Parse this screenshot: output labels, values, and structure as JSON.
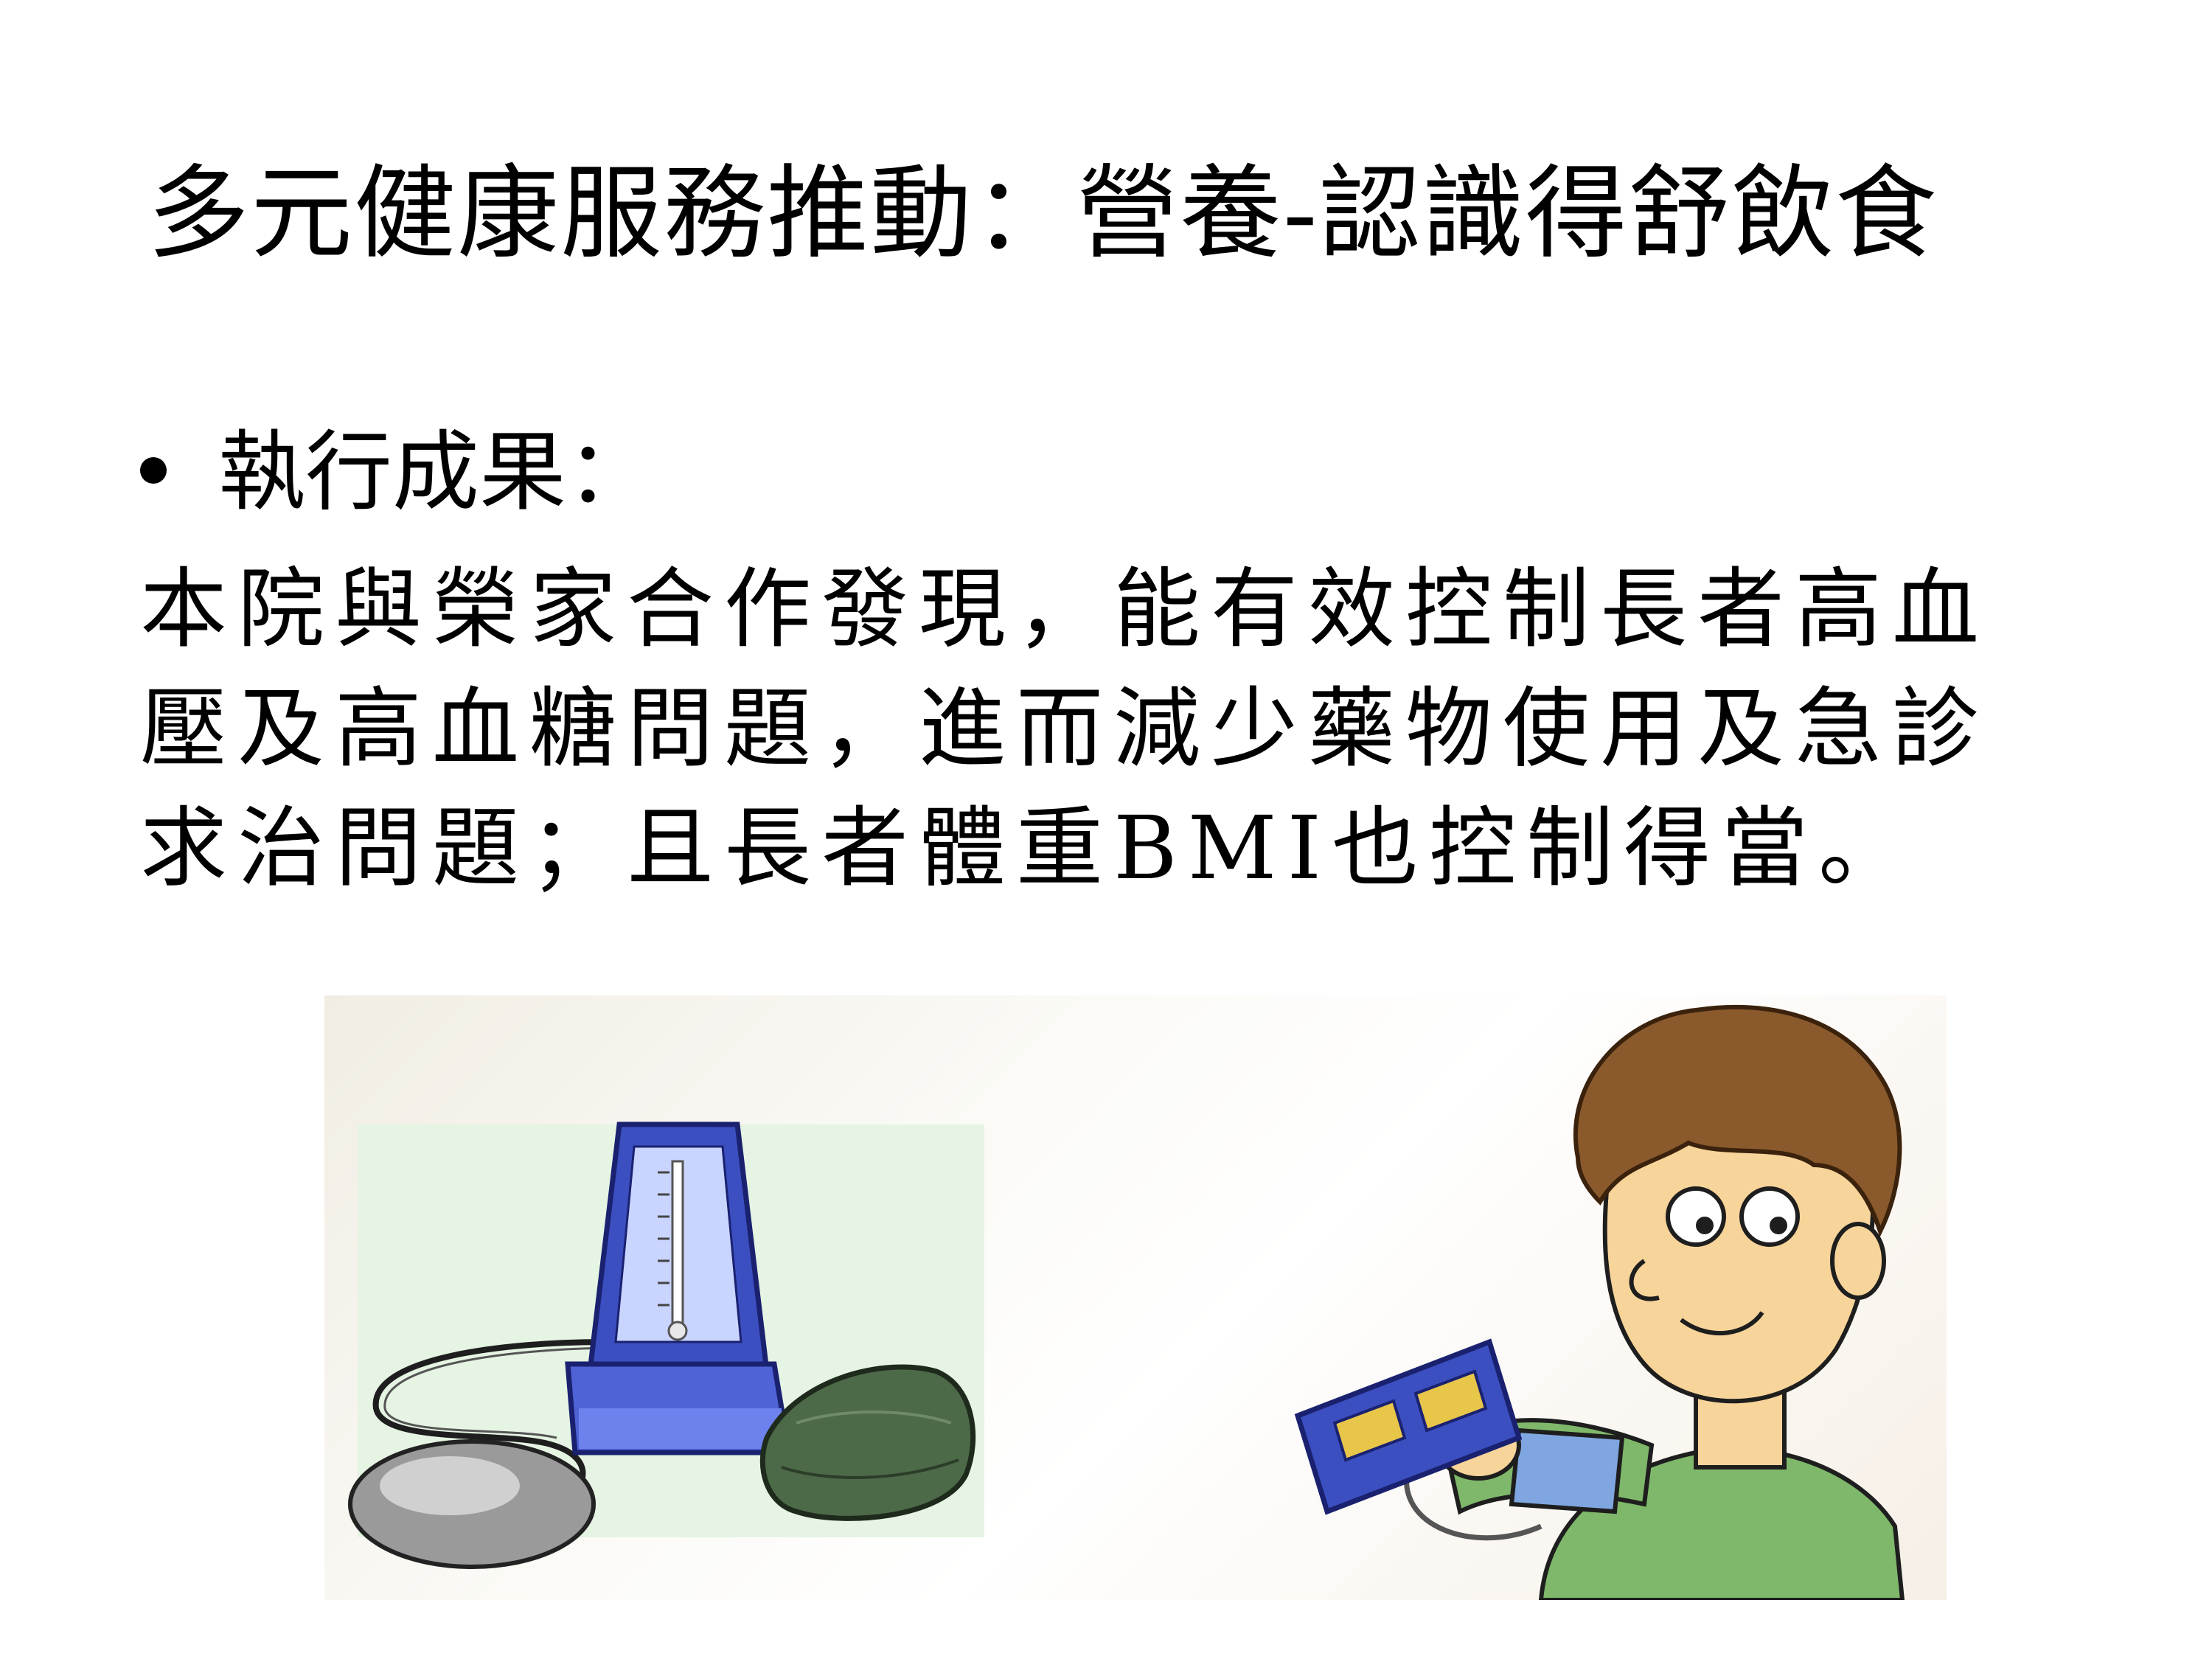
{
  "slide": {
    "title": "多元健康服務推動：營養-認識得舒飲食",
    "bullet": "執行成果：",
    "body_lines": [
      "本院與榮家合作發現，能有效控制長者高血",
      "壓及高血糖問題，進而減少藥物使用及急診",
      "求治問題；且長者體重BMI也控制得當。"
    ]
  },
  "illustration": {
    "left_icon": "sphygmomanometer-icon",
    "right_icon": "person-measuring-blood-pressure-icon",
    "colors": {
      "device_blue": "#3c4fc0",
      "cuff_green": "#4d6a48",
      "shirt_green": "#7fb86a",
      "hair_brown": "#8a5a2c",
      "skin": "#f7d49a",
      "panel_bg": "#e6f4e3"
    }
  }
}
